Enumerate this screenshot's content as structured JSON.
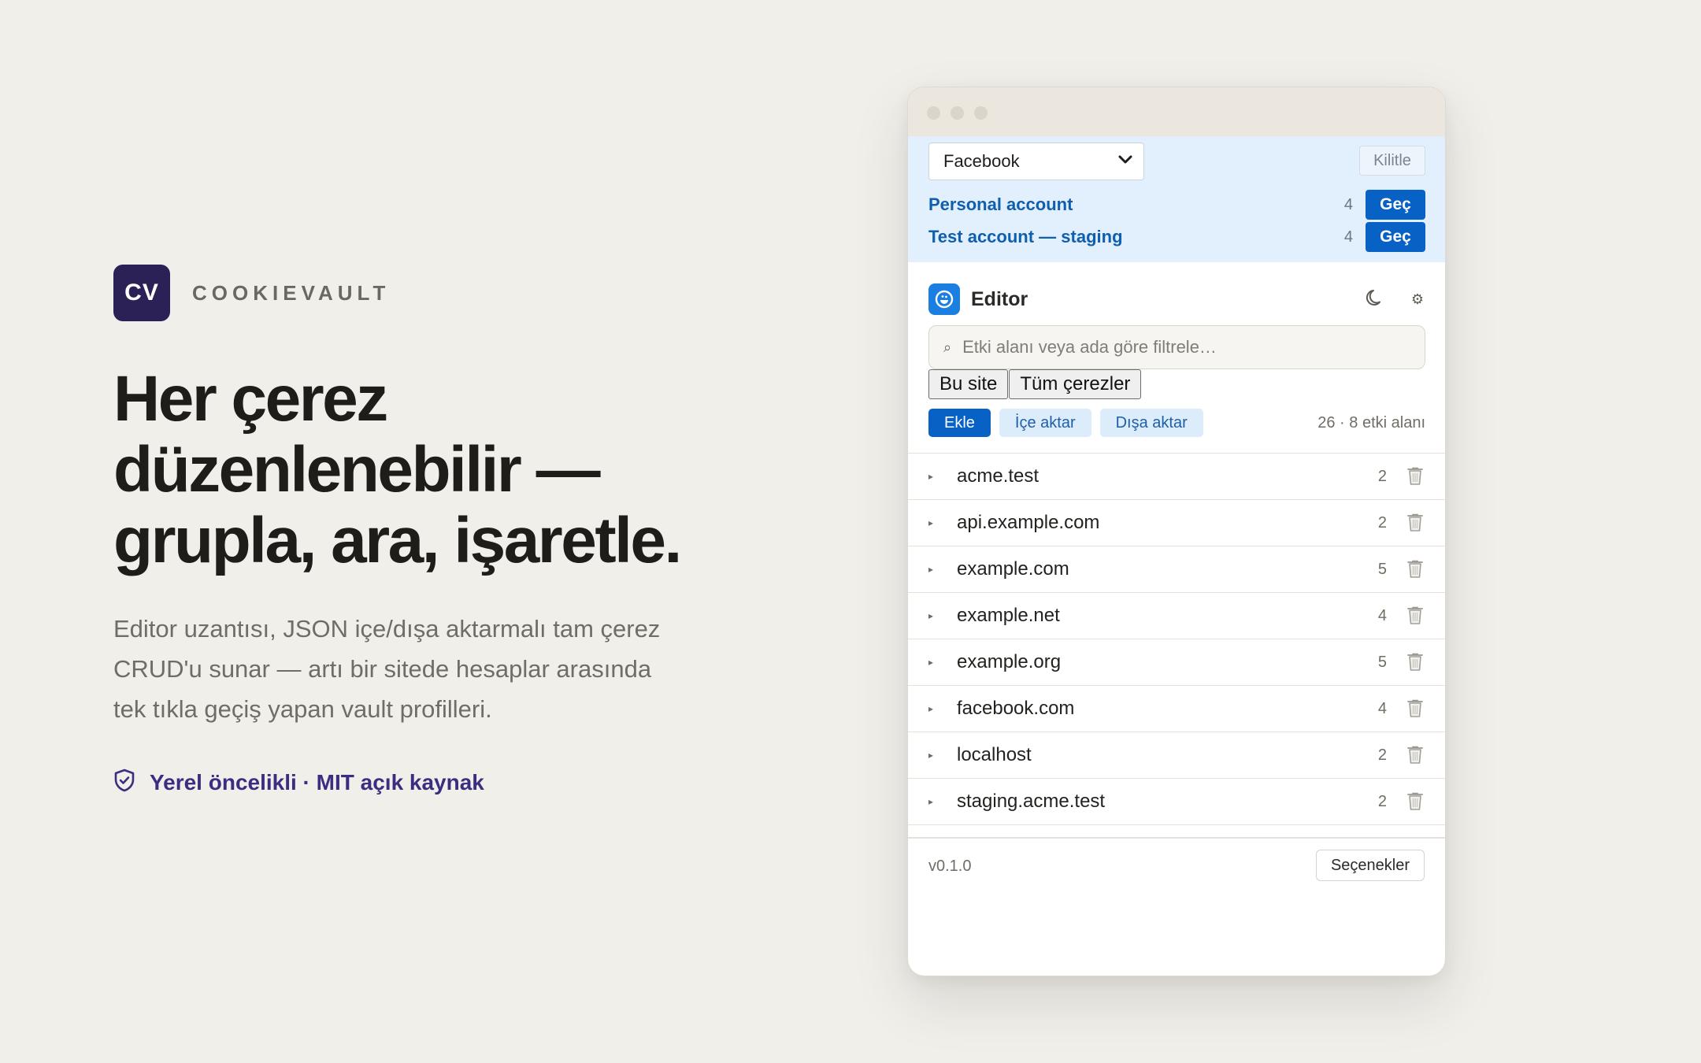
{
  "brand": {
    "logo": "CV",
    "name": "COOKIEVAULT"
  },
  "hero": {
    "headline_lines": [
      "Her çerez",
      "düzenlenebilir —",
      "grupla, ara, işaretle."
    ],
    "lead_lines": [
      "Editor uzantısı, JSON içe/dışa aktarmalı tam çerez",
      "CRUD'u sunar — artı bir sitede hesaplar arasında",
      "tek tıkla geçiş yapan vault profilleri."
    ],
    "badge": "Yerel öncelikli · MIT açık kaynak",
    "badge_icon": "shield-check-icon"
  },
  "vault": {
    "profile_selected": "Facebook",
    "lock_label": "Kilitle",
    "accounts": [
      {
        "name": "Personal account",
        "count": "4",
        "action": "Geç"
      },
      {
        "name": "Test account — staging",
        "count": "4",
        "action": "Geç"
      }
    ]
  },
  "editor": {
    "title": "Editor",
    "theme_icon": "moon-icon",
    "settings_icon": "gear-icon",
    "filter_placeholder": "Etki alanı veya ada göre filtrele…",
    "scope": [
      "Bu site",
      "Tüm çerezler"
    ],
    "actions": {
      "add": "Ekle",
      "import": "İçe aktar",
      "export": "Dışa aktar"
    },
    "stats": "26 · 8 etki alanı",
    "domains": [
      {
        "name": "acme.test",
        "count": "2"
      },
      {
        "name": "api.example.com",
        "count": "2"
      },
      {
        "name": "example.com",
        "count": "5"
      },
      {
        "name": "example.net",
        "count": "4"
      },
      {
        "name": "example.org",
        "count": "5"
      },
      {
        "name": "facebook.com",
        "count": "4"
      },
      {
        "name": "localhost",
        "count": "2"
      },
      {
        "name": "staging.acme.test",
        "count": "2"
      }
    ],
    "version": "v0.1.0",
    "options_label": "Seçenekler"
  },
  "colors": {
    "accent": "#0862c6",
    "brand": "#2b2157",
    "vault_bg": "#e2effc",
    "page_bg": "#f1efea"
  }
}
